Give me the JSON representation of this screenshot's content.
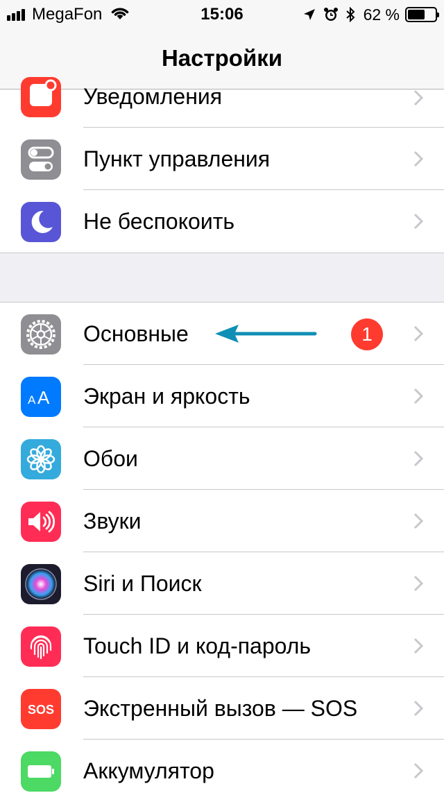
{
  "status_bar": {
    "carrier": "MegaFon",
    "time": "15:06",
    "battery_percent": "62 %",
    "battery_level": 0.62,
    "icons": [
      "signal-icon",
      "wifi-icon",
      "location-icon",
      "alarm-icon",
      "bluetooth-icon",
      "battery-icon"
    ]
  },
  "nav": {
    "title": "Настройки"
  },
  "groups": [
    {
      "items": [
        {
          "label": "Уведомления",
          "icon": "notifications-icon",
          "color": "#ff3b30"
        },
        {
          "label": "Пункт управления",
          "icon": "control-center-icon",
          "color": "#8e8e93"
        },
        {
          "label": "Не беспокоить",
          "icon": "moon-icon",
          "color": "#5856d6"
        }
      ]
    },
    {
      "items": [
        {
          "label": "Основные",
          "icon": "gear-icon",
          "color": "#8e8e93",
          "badge": "1"
        },
        {
          "label": "Экран и яркость",
          "icon": "display-text-icon",
          "color": "#007aff",
          "icon_text": "AA"
        },
        {
          "label": "Обои",
          "icon": "flower-icon",
          "color": "#35aadc"
        },
        {
          "label": "Звуки",
          "icon": "speaker-icon",
          "color": "#ff2d55"
        },
        {
          "label": "Siri и Поиск",
          "icon": "siri-icon",
          "color": "#1c1c2e"
        },
        {
          "label": "Touch ID и код-пароль",
          "icon": "fingerprint-icon",
          "color": "#ff2d55"
        },
        {
          "label": "Экстренный вызов — SOS",
          "icon": "sos-icon",
          "color": "#ff3b30",
          "icon_text": "SOS"
        },
        {
          "label": "Аккумулятор",
          "icon": "battery-icon",
          "color": "#4cd964"
        }
      ]
    }
  ],
  "annotation": {
    "icon": "arrow-left-icon",
    "color": "#0f8fb5"
  }
}
